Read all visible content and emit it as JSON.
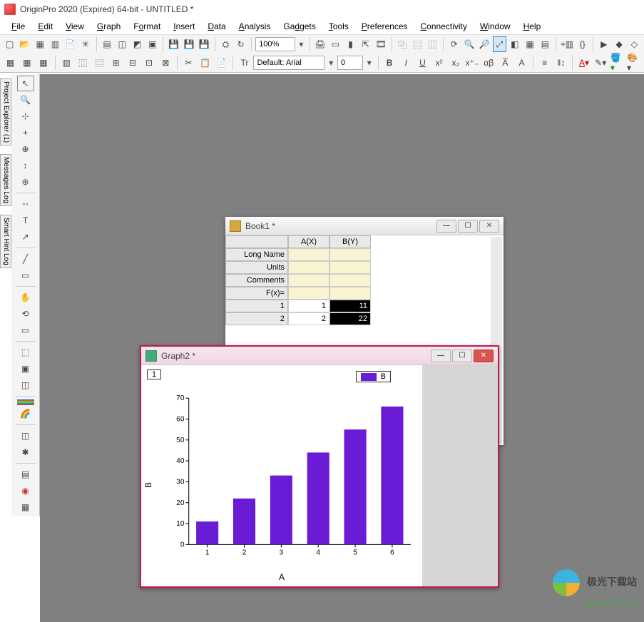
{
  "app": {
    "title": "OriginPro 2020 (Expired) 64-bit - UNTITLED *"
  },
  "menu": {
    "file": "File",
    "edit": "Edit",
    "view": "View",
    "graph": "Graph",
    "format": "Format",
    "insert": "Insert",
    "data": "Data",
    "analysis": "Analysis",
    "gadgets": "Gadgets",
    "tools": "Tools",
    "preferences": "Preferences",
    "connectivity": "Connectivity",
    "window": "Window",
    "help": "Help"
  },
  "toolbar": {
    "zoom": "100%",
    "font": "Default: Arial",
    "font_size": "0"
  },
  "left_panels": {
    "project_explorer": "Project Explorer (1)",
    "messages_log": "Messages Log",
    "smart_hint_log": "Smart Hint Log"
  },
  "book": {
    "title": "Book1 *",
    "min": "—",
    "max": "☐",
    "close": "✕",
    "col_a": "A(X)",
    "col_b": "B(Y)",
    "long_name": "Long Name",
    "units": "Units",
    "comments": "Comments",
    "fx": "F(x)=",
    "rows": [
      {
        "r": "1",
        "a": "1",
        "b": "11"
      },
      {
        "r": "2",
        "a": "2",
        "b": "22"
      }
    ]
  },
  "graph": {
    "title": "Graph2 *",
    "page_num": "1",
    "legend_label": "B",
    "xlabel": "A",
    "ylabel": "B"
  },
  "chart_data": {
    "type": "bar",
    "categories": [
      "1",
      "2",
      "3",
      "4",
      "5",
      "6"
    ],
    "values": [
      11,
      22,
      33,
      44,
      55,
      66
    ],
    "xlabel": "A",
    "ylabel": "B",
    "ylim": [
      0,
      70
    ],
    "yticks": [
      0,
      10,
      20,
      30,
      40,
      50,
      60,
      70
    ],
    "legend": [
      "B"
    ],
    "colors": [
      "#6a1bd6"
    ]
  },
  "watermark": {
    "cn": "极光下载站",
    "url": "www.xz7.com"
  }
}
